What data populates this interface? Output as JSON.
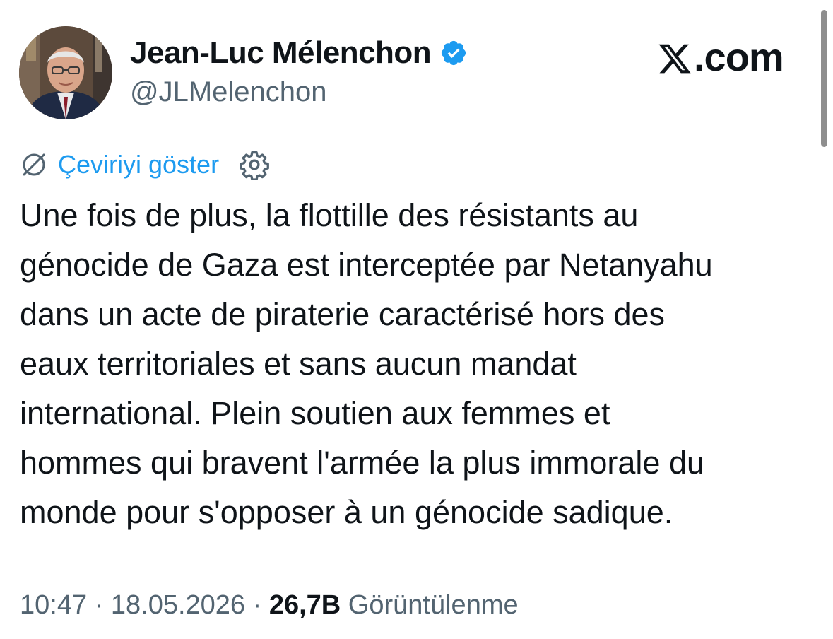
{
  "author": {
    "display_name": "Jean-Luc Mélenchon",
    "handle": "@JLMelenchon",
    "verified_icon": "verified-badge-icon",
    "verified_color": "#1d9bf0"
  },
  "brand": {
    "label": ".com",
    "logo_icon": "x-logo-icon"
  },
  "translation": {
    "label": "Çeviriyi göster",
    "icon": "translate-globe-icon",
    "settings_icon": "gear-icon",
    "link_color": "#1d9bf0"
  },
  "tweet": {
    "lines": [
      "Une fois de plus, la flottille des résistants au",
      "génocide de Gaza est interceptée par Netanyahu",
      "dans un acte de piraterie caractérisé hors des",
      "eaux territoriales et sans aucun mandat",
      "international. Plein soutien aux femmes et",
      "hommes qui bravent l'armée la plus immorale du",
      "monde pour s'opposer à un génocide sadique."
    ]
  },
  "meta": {
    "time": "10:47",
    "separator": " · ",
    "date": "18.05.2026",
    "views_count": "26,7B",
    "views_label": " Görüntülenme"
  },
  "colors": {
    "text_primary": "#0f1419",
    "text_secondary": "#536471",
    "accent": "#1d9bf0"
  }
}
